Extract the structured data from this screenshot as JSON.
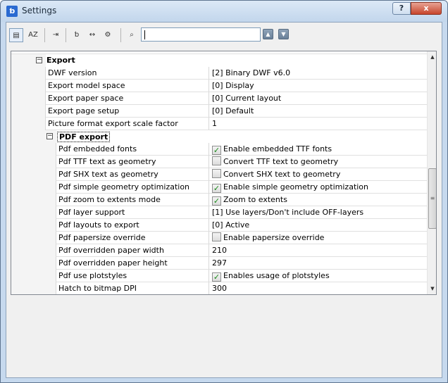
{
  "window": {
    "title": "Settings",
    "app_icon": "bricscad-icon",
    "help_label": "?",
    "close_label": "x"
  },
  "toolbar": {
    "search_value": "",
    "tools": [
      {
        "name": "categorized-view-icon",
        "glyph": "▤",
        "active": true
      },
      {
        "name": "alphabetical-sort-icon",
        "glyph": "AZ",
        "active": false
      },
      {
        "name": "export-icon",
        "glyph": "⇥",
        "active": false
      },
      {
        "name": "app-settings-icon",
        "glyph": "ƅ",
        "active": false
      },
      {
        "name": "dimension-icon",
        "glyph": "↔",
        "active": false
      },
      {
        "name": "gear-settings-icon",
        "glyph": "⚙",
        "active": false
      },
      {
        "name": "binoculars-icon",
        "glyph": "⌕",
        "active": false
      }
    ],
    "up_glyph": "▲",
    "down_glyph": "▼"
  },
  "grid": {
    "export_group": "Export",
    "pdf_group": "PDF export",
    "export_rows": [
      {
        "name": "DWF version",
        "value": "[2] Binary DWF v6.0"
      },
      {
        "name": "Export model space",
        "value": "[0] Display"
      },
      {
        "name": "Export paper space",
        "value": "[0] Current layout"
      },
      {
        "name": "Export page setup",
        "value": "[0] Default"
      },
      {
        "name": "Picture format export scale factor",
        "value": "1"
      }
    ],
    "pdf_rows": [
      {
        "name": "Pdf embedded fonts",
        "value": "Enable embedded TTF fonts",
        "checkbox": true,
        "checked": true
      },
      {
        "name": "Pdf TTF text as geometry",
        "value": "Convert TTF text to geometry",
        "checkbox": true,
        "checked": false
      },
      {
        "name": "Pdf SHX text as geometry",
        "value": "Convert SHX text to geometry",
        "checkbox": true,
        "checked": false
      },
      {
        "name": "Pdf simple geometry optimization",
        "value": "Enable simple geometry optimization",
        "checkbox": true,
        "checked": true
      },
      {
        "name": "Pdf zoom to extents mode",
        "value": "Zoom to extents",
        "checkbox": true,
        "checked": true
      },
      {
        "name": "Pdf layer support",
        "value": "[1] Use layers/Don't include OFF-layers",
        "checkbox": false
      },
      {
        "name": "Pdf layouts to export",
        "value": "[0] Active",
        "checkbox": false
      },
      {
        "name": "Pdf papersize override",
        "value": "Enable papersize override",
        "checkbox": true,
        "checked": false
      },
      {
        "name": "Pdf overridden paper width",
        "value": "210",
        "checkbox": false
      },
      {
        "name": "Pdf overridden paper height",
        "value": "297",
        "checkbox": false
      },
      {
        "name": "Pdf use plotstyles",
        "value": "Enables usage of plotstyles",
        "checkbox": true,
        "checked": true
      },
      {
        "name": "Hatch to bitmap DPI",
        "value": "300",
        "checkbox": false
      }
    ]
  }
}
